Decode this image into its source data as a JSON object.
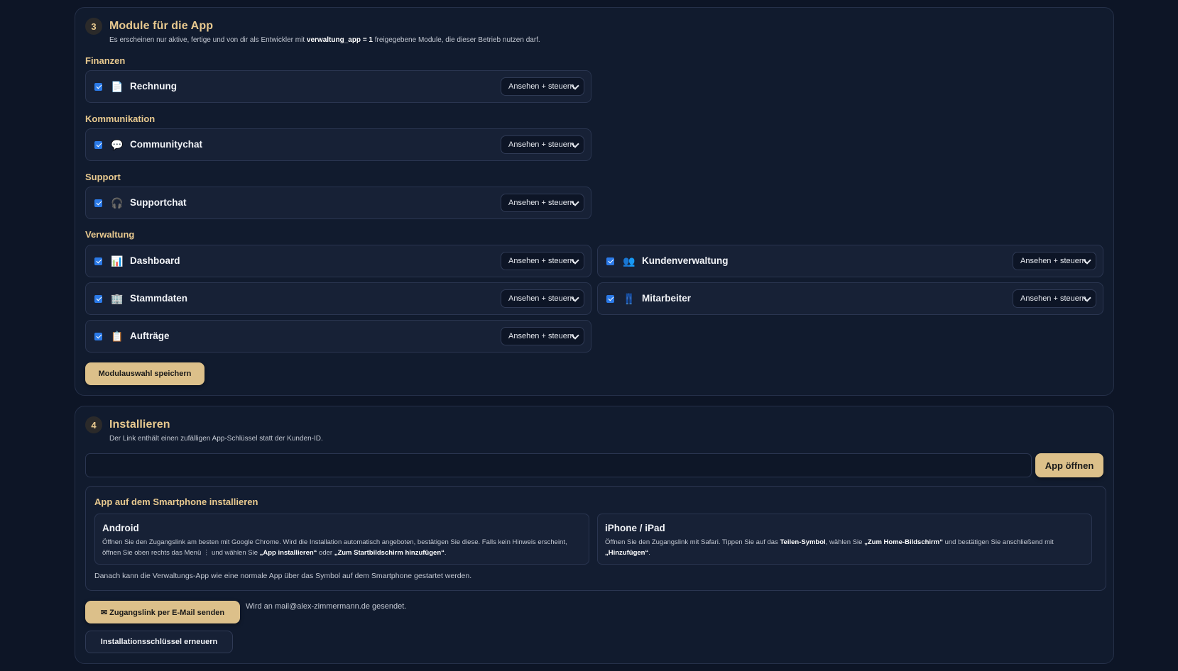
{
  "section3": {
    "step": "3",
    "title": "Module für die App",
    "subtitle_pre": "Es erscheinen nur aktive, fertige und von dir als Entwickler mit ",
    "subtitle_bold": "verwaltung_app = 1",
    "subtitle_post": " freigegebene Module, die dieser Betrieb nutzen darf.",
    "select_label": "Ansehen + steuern",
    "categories": [
      {
        "name": "Finanzen",
        "modules": [
          {
            "label": "Rechnung",
            "icon": "document-icon"
          }
        ]
      },
      {
        "name": "Kommunikation",
        "modules": [
          {
            "label": "Communitychat",
            "icon": "speech-bubble-icon"
          }
        ]
      },
      {
        "name": "Support",
        "modules": [
          {
            "label": "Supportchat",
            "icon": "headphones-icon"
          }
        ]
      },
      {
        "name": "Verwaltung",
        "modules": [
          {
            "label": "Dashboard",
            "icon": "bar-chart-icon"
          },
          {
            "label": "Kundenverwaltung",
            "icon": "people-icon"
          },
          {
            "label": "Stammdaten",
            "icon": "office-building-icon"
          },
          {
            "label": "Mitarbeiter",
            "icon": "jeans-icon"
          },
          {
            "label": "Aufträge",
            "icon": "clipboard-icon"
          }
        ]
      }
    ],
    "save_label": "Modulauswahl speichern"
  },
  "section4": {
    "step": "4",
    "title": "Installieren",
    "subtitle": "Der Link enthält einen zufälligen App-Schlüssel statt der Kunden-ID.",
    "link_value": "",
    "open_label": "App öffnen",
    "install_title": "App auf dem Smartphone installieren",
    "android": {
      "title": "Android",
      "t1": "Öffnen Sie den Zugangslink am besten mit Google Chrome. Wird die Installation automatisch angeboten, bestätigen Sie diese. Falls kein Hinweis erscheint, öffnen Sie oben rechts das Menü ⋮ und wählen Sie ",
      "b1": "„App installieren“",
      "t2": " oder ",
      "b2": "„Zum Startbildschirm hinzufügen“",
      "t3": "."
    },
    "ios": {
      "title": "iPhone / iPad",
      "t1": "Öffnen Sie den Zugangslink mit Safari. Tippen Sie auf das ",
      "b1": "Teilen-Symbol",
      "t2": ", wählen Sie ",
      "b2": "„Zum Home-Bildschirm“",
      "t3": " und bestätigen Sie anschließend mit ",
      "b3": "„Hinzufügen“",
      "t4": "."
    },
    "footer": "Danach kann die Verwaltungs-App wie eine normale App über das Symbol auf dem Smartphone gestartet werden.",
    "mail_button": "✉ Zugangslink per E-Mail senden",
    "mail_note": "Wird an mail@alex-zimmermann.de gesendet.",
    "renew_label": "Installationsschlüssel erneuern"
  }
}
